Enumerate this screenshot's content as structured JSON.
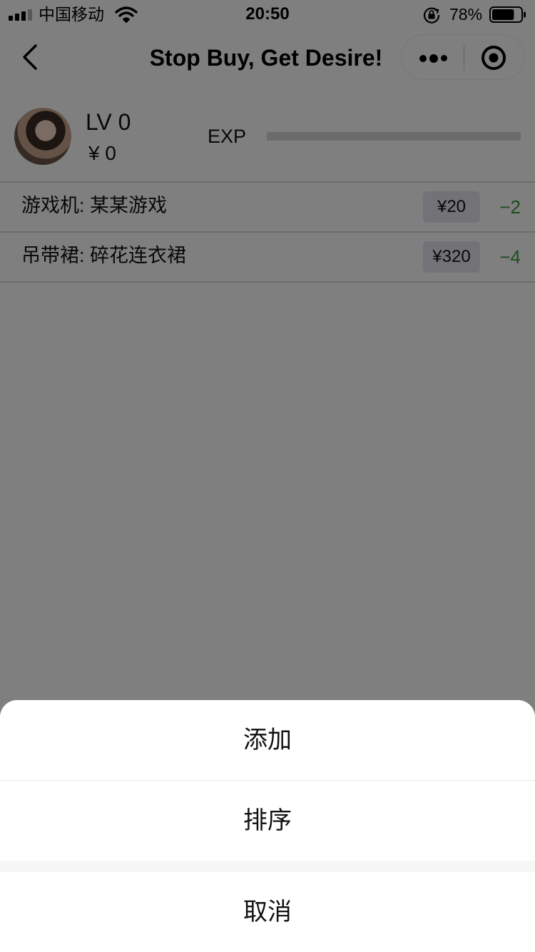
{
  "status_bar": {
    "carrier": "中国移动",
    "time": "20:50",
    "battery_percent": "78%",
    "battery_level": 0.78,
    "icons": [
      "signal-icon",
      "wifi-icon",
      "rotation-lock-icon",
      "battery-icon"
    ]
  },
  "nav": {
    "title": "Stop Buy, Get Desire!",
    "back_icon": "chevron-left-icon",
    "more_icon": "more-dots-icon",
    "close_icon": "target-close-icon"
  },
  "profile": {
    "level": "LV 0",
    "money": "¥  0",
    "exp_label": "EXP",
    "exp_progress": 0
  },
  "items": [
    {
      "label": "游戏机: 某某游戏",
      "price": "¥20",
      "count": "−2"
    },
    {
      "label": "吊带裙: 碎花连衣裙",
      "price": "¥320",
      "count": "−4"
    }
  ],
  "action_sheet": {
    "options": [
      "添加",
      "排序"
    ],
    "cancel": "取消"
  },
  "colors": {
    "overlay": "#000000",
    "count_green": "#3d9b3d",
    "price_tag_bg": "#e6e6ee"
  }
}
